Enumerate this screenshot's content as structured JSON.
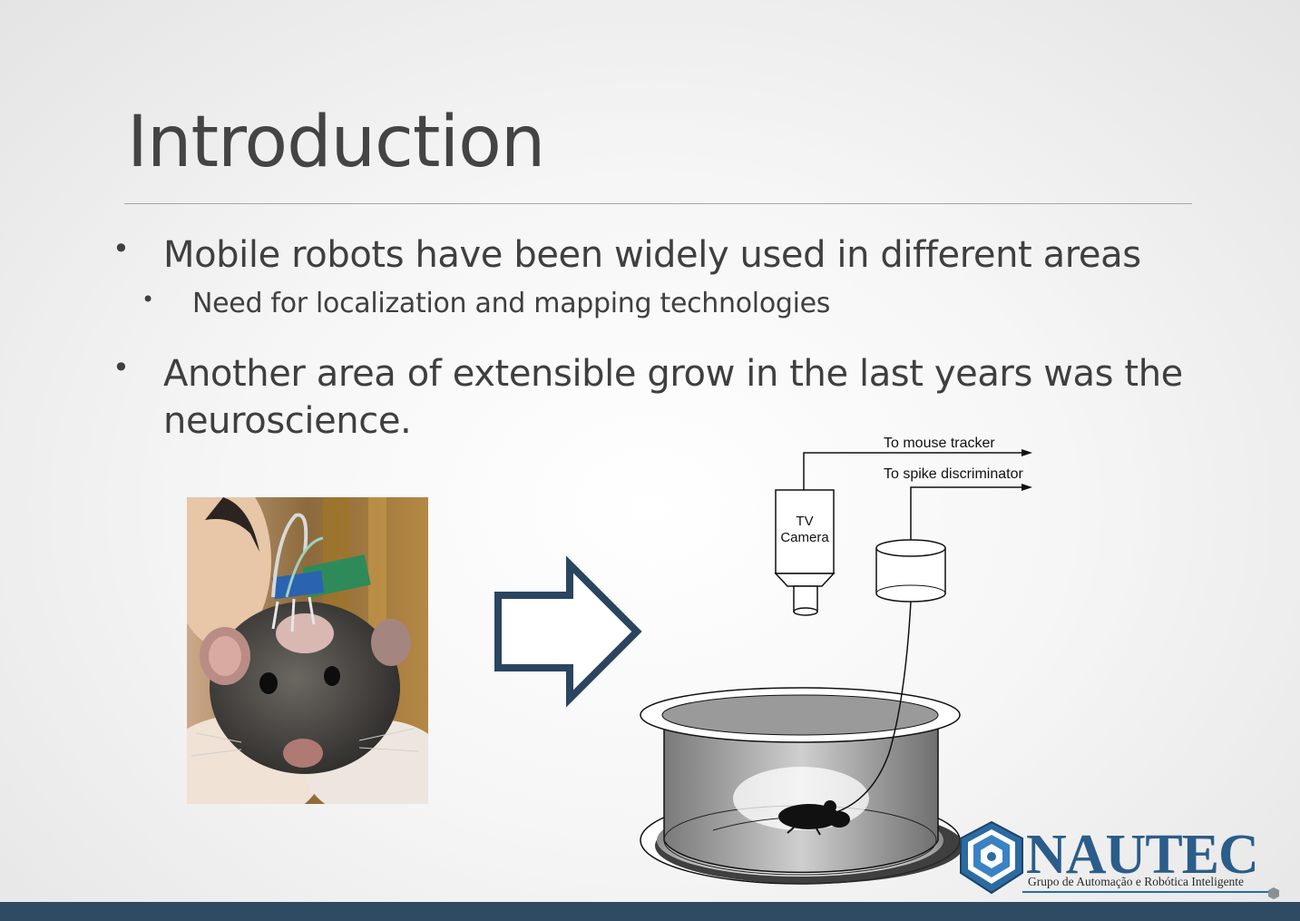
{
  "slide": {
    "title": "Introduction",
    "bullets": [
      {
        "level": 1,
        "text": "Mobile robots have been widely used in different areas"
      },
      {
        "level": 2,
        "text": "Need for localization and mapping technologies"
      },
      {
        "level": 1,
        "text": "Another area of extensible grow in the  last years was the neuroscience."
      }
    ],
    "bullet_glyph": "•"
  },
  "diagram": {
    "label_tracker": "To mouse tracker",
    "label_spike": "To spike discriminator",
    "camera_label_1": "TV",
    "camera_label_2": "Camera"
  },
  "logo": {
    "name": "NAUTEC",
    "tagline": "Grupo de Automação e Robótica Inteligente"
  },
  "colors": {
    "accent": "#2f4a63",
    "text": "#3f3f3f",
    "logo_blue": "#2b5d8a"
  }
}
